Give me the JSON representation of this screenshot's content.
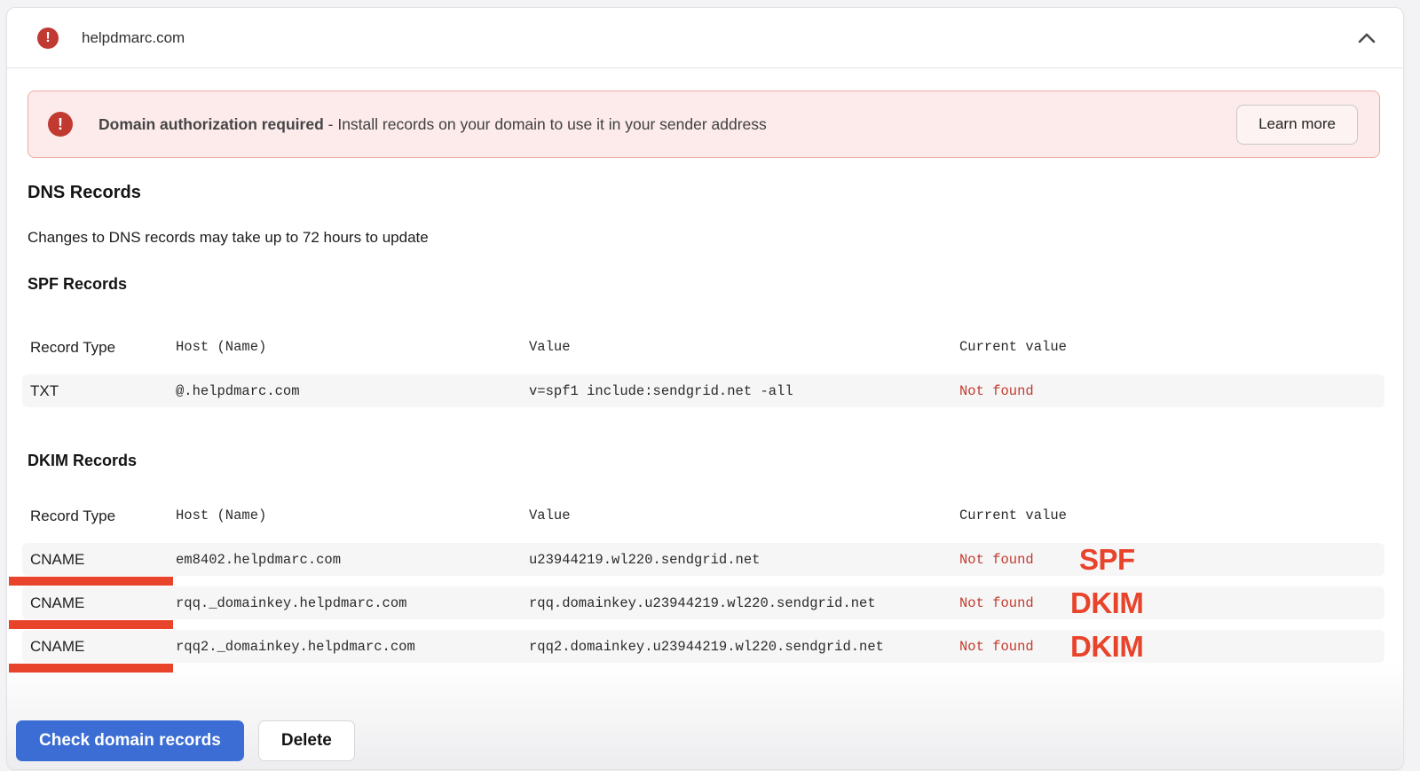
{
  "accordion": {
    "domain": "helpdmarc.com",
    "status_icon": "error-exclamation",
    "chevron_icon": "chevron-up"
  },
  "alert": {
    "title_bold": "Domain authorization required",
    "message": " - Install records on your domain to use it in your sender address",
    "button_label": "Learn more"
  },
  "dns": {
    "heading": "DNS Records",
    "note": "Changes to DNS records may take up to 72 hours to update"
  },
  "spf": {
    "heading": "SPF Records",
    "columns": [
      "Record Type",
      "Host (Name)",
      "Value",
      "Current value"
    ],
    "rows": [
      {
        "type": "TXT",
        "host": "@.helpdmarc.com",
        "value": "v=spf1 include:sendgrid.net -all",
        "current": "Not found"
      }
    ]
  },
  "dkim": {
    "heading": "DKIM Records",
    "columns": [
      "Record Type",
      "Host (Name)",
      "Value",
      "Current value"
    ],
    "rows": [
      {
        "type": "CNAME",
        "host": "em8402.helpdmarc.com",
        "value": "u23944219.wl220.sendgrid.net",
        "current": "Not found",
        "annotation": "SPF"
      },
      {
        "type": "CNAME",
        "host": "rqq._domainkey.helpdmarc.com",
        "value": "rqq.domainkey.u23944219.wl220.sendgrid.net",
        "current": "Not found",
        "annotation": "DKIM"
      },
      {
        "type": "CNAME",
        "host": "rqq2._domainkey.helpdmarc.com",
        "value": "rqq2.domainkey.u23944219.wl220.sendgrid.net",
        "current": "Not found",
        "annotation": "DKIM"
      }
    ]
  },
  "actions": {
    "check_label": "Check domain records",
    "delete_label": "Delete"
  },
  "colors": {
    "annotation_red": "#e8442b",
    "status_red": "#c23b2e",
    "icon_red": "#c13a31",
    "primary_blue": "#3b6dd4",
    "alert_bg": "#fcebea"
  }
}
